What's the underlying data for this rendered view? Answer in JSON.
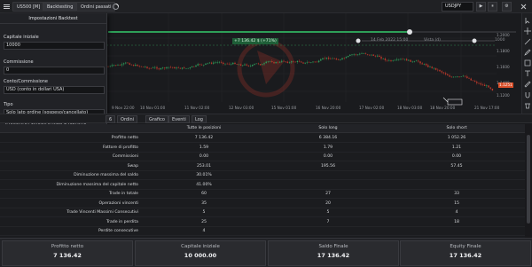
{
  "topbar": {
    "tabs": [
      "US500 [M]",
      "Backtesting",
      "Ordini passati"
    ],
    "symbol": "USDJPY",
    "buttons": [
      "▶",
      "⏸",
      "⚙"
    ]
  },
  "chart": {
    "trade_label": "+7 136.42 $ (+71%)",
    "period_text": "14 Feb 2022 15:00",
    "slider_label": "Vista (d)",
    "slider_value": "1000",
    "price_axis": [
      "1.2000",
      "1.1800",
      "1.1600",
      "1.1400",
      "1.1200"
    ],
    "date_axis": [
      "9 Nov 22:00",
      "10 Nov 01:00",
      "11 Nov 02:00",
      "12 Nov 03:00",
      "15 Nov 01:00",
      "16 Nov 20:00",
      "17 Nov 02:00",
      "18 Nov 03:00",
      "18 Nov 20:00",
      "21 Nov 17:00"
    ],
    "last_price": "1.1251",
    "colors": {
      "up": "#2fa15c",
      "down": "#c0392b",
      "accent": "#f0a020"
    }
  },
  "settings": {
    "title": "Impostazioni Backtest",
    "fields": [
      {
        "label": "Capitale iniziale",
        "value": "10000"
      },
      {
        "label": "Commissione",
        "value": "0"
      },
      {
        "label": "Conto/Commissione",
        "value": "USD (conto in dollari USA)"
      },
      {
        "label": "Tipo",
        "value": "Solo lato ordine (sospeso/cancellato)"
      }
    ],
    "note": "Il profitto è calcolato in base al prezzo di apertura e di chiusura della posizione, al netto di commissioni e costi."
  },
  "tabs": [
    "Sommario",
    "Ordini",
    "Grafico",
    "Eventi",
    "Log"
  ],
  "tabs_count": "6",
  "table": {
    "headers": [
      "",
      "Tutte le posizioni",
      "Solo long",
      "Solo short"
    ],
    "rows": [
      [
        "Profitto netto",
        "7 136.42",
        "6 384.16",
        "1 052.26"
      ],
      [
        "Fattore di profitto",
        "1.59",
        "1.79",
        "1.21"
      ],
      [
        "Commissioni",
        "0.00",
        "0.00",
        "0.00"
      ],
      [
        "Swap",
        "253.01",
        "195.56",
        "57.45"
      ],
      [
        "Diminuzione massima del saldo",
        "30.01%",
        "",
        ""
      ],
      [
        "Diminuzione massima del capitale netto",
        "41.00%",
        "",
        ""
      ],
      [
        "Trade in totale",
        "60",
        "27",
        "33"
      ],
      [
        "Operazioni vincenti",
        "35",
        "20",
        "15"
      ],
      [
        "Trade Vincenti Massimi Consecutivi",
        "5",
        "5",
        "4"
      ],
      [
        "Trade in perdita",
        "25",
        "7",
        "18"
      ],
      [
        "Perdite consecutive",
        "4",
        "",
        ""
      ]
    ]
  },
  "summary": [
    {
      "label": "Profitto netto",
      "value": "7 136.42"
    },
    {
      "label": "Capitale iniziale",
      "value": "10 000.00"
    },
    {
      "label": "Saldo Finale",
      "value": "17 136.42"
    },
    {
      "label": "Equity Finale",
      "value": "17 136.42"
    }
  ]
}
